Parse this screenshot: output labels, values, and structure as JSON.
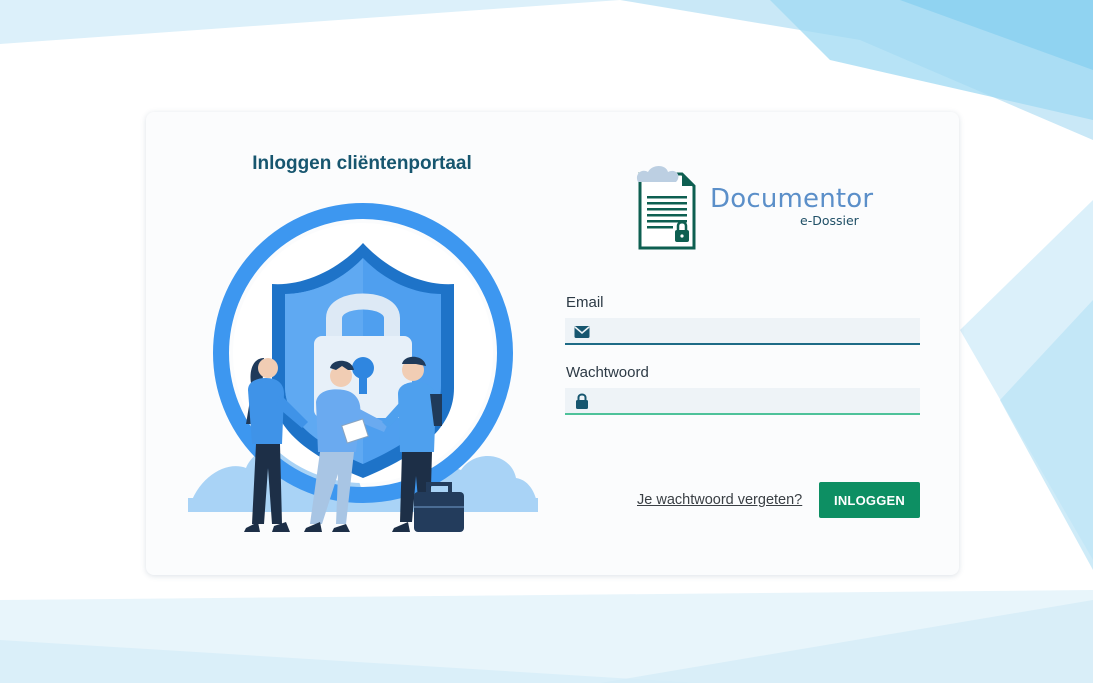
{
  "portal": {
    "title": "Inloggen cliëntenportaal"
  },
  "logo": {
    "name": "Documentor",
    "sub": "e-Dossier"
  },
  "form": {
    "email_label": "Email",
    "email_value": "",
    "password_label": "Wachtwoord",
    "password_value": "",
    "forgot_link": "Je wachtwoord vergeten?",
    "login_button": "INLOGGEN"
  },
  "icons": {
    "email": "envelope-icon",
    "password": "lock-icon"
  },
  "colors": {
    "title": "#17566f",
    "button": "#0d8f63",
    "logo_text": "#5b8fc9",
    "email_underline": "#1e6b86",
    "password_underline": "#4ec29a"
  }
}
